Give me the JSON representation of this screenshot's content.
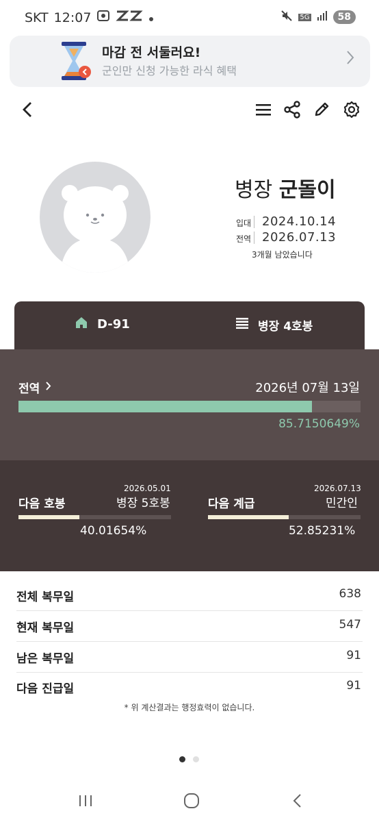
{
  "status_bar": {
    "carrier": "SKT",
    "time": "12:07",
    "network": "5G",
    "battery": "58"
  },
  "banner": {
    "title": "마감 전 서둘러요!",
    "subtitle": "군인만 신청 가능한 라식 혜택"
  },
  "profile": {
    "rank": "병장",
    "name": "군돌이",
    "enlist_label": "입대",
    "enlist_date": "2024.10.14",
    "discharge_label": "전역",
    "discharge_date": "2026.07.13",
    "remaining": "3개월 남았습니다"
  },
  "tabs": {
    "dday": "D-91",
    "rank_step": "병장 4호봉"
  },
  "discharge_progress": {
    "label": "전역",
    "date": "2026년 07월 13일",
    "percent_text": "85.7150649%",
    "fraction": 0.857
  },
  "next_step": {
    "label": "다음 호봉",
    "date": "2026.05.01",
    "value": "병장 5호봉",
    "percent_text": "40.01654%",
    "fraction": 0.4
  },
  "next_rank": {
    "label": "다음 계급",
    "date": "2026.07.13",
    "value": "민간인",
    "percent_text": "52.85231%",
    "fraction": 0.5285
  },
  "stats": [
    {
      "label": "전체 복무일",
      "value": "638"
    },
    {
      "label": "현재 복무일",
      "value": "547"
    },
    {
      "label": "남은 복무일",
      "value": "91"
    },
    {
      "label": "다음 진급일",
      "value": "91"
    }
  ],
  "note": "* 위 계산결과는 행정효력이 없습니다.",
  "colors": {
    "accent_green": "#8ec9ad",
    "dark_panel": "#433838",
    "mid_panel": "#584c4c",
    "cream_fill": "#f4eed8"
  },
  "icons": {
    "back": "chevron-left-icon",
    "menu": "menu-icon",
    "share": "share-icon",
    "edit": "pencil-icon",
    "settings": "gear-icon",
    "home": "home-icon",
    "list": "list-icon"
  }
}
